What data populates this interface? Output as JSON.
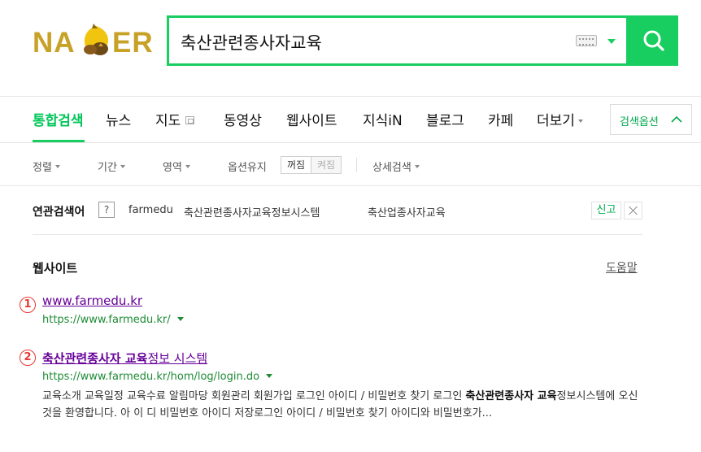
{
  "brand": {
    "logo_left": "NA",
    "logo_right": "ER",
    "accent": "#19ce60",
    "logo_color": "#c8a227"
  },
  "search": {
    "query": "축산관련종사자교육"
  },
  "tabs": [
    {
      "label": "통합검색",
      "active": true
    },
    {
      "label": "뉴스"
    },
    {
      "label": "지도"
    },
    {
      "label": "동영상"
    },
    {
      "label": "웹사이트"
    },
    {
      "label": "지식iN"
    },
    {
      "label": "블로그"
    },
    {
      "label": "카페"
    },
    {
      "label": "더보기"
    }
  ],
  "search_options_label": "검색옵션",
  "filters": {
    "sort": "정렬",
    "period": "기간",
    "area": "영역",
    "option_keep": "옵션유지",
    "on": "꺼짐",
    "off": "켜짐",
    "detail": "상세검색"
  },
  "related": {
    "title": "연관검색어",
    "help": "?",
    "keywords": [
      "farmedu",
      "축산관련종사자교육정보시스템",
      "축산업종사자교육"
    ],
    "report": "신고"
  },
  "section": {
    "title": "웹사이트",
    "help_link": "도움말"
  },
  "results": [
    {
      "marker": "1",
      "title": "www.farmedu.kr",
      "url": "https://www.farmedu.kr/"
    },
    {
      "marker": "2",
      "title_bold": "축산관련종사자 교육",
      "title_rest": "정보 시스템",
      "url": "https://www.farmedu.kr/hom/log/login.do",
      "desc_1": "교육소개 교육일정 교육수료 알림마당 회원관리 회원가입 로그인 아이디 / 비밀번호 찾기 로그인 ",
      "desc_bold_1": "축산관련종사자 교육",
      "desc_2": "정보시스템에 오신것을 환영합니다. 아 이 디 비밀번호 아이디 저장로그인 아이디 / 비밀번호 찾기 아이디와 비밀번호가..."
    }
  ]
}
